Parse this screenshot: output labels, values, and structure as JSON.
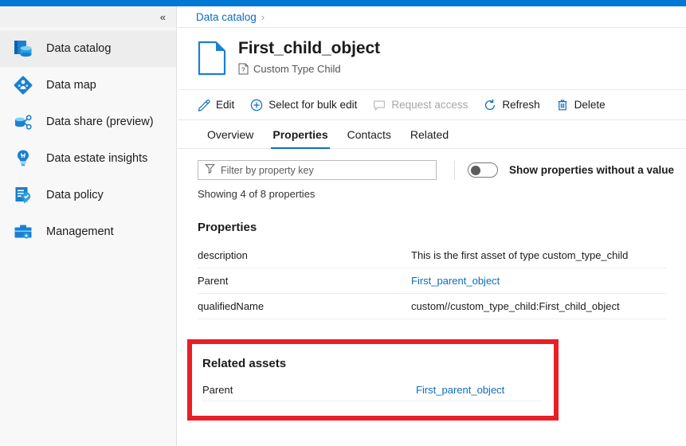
{
  "theme": {
    "accent": "#0078d4",
    "link": "#0f6cbd",
    "highlight_box": "#e81f25",
    "text": "#1b1b1b",
    "disabled": "#a6a6a6"
  },
  "sidebar": {
    "collapse_label": "«",
    "items": [
      {
        "label": "Data catalog",
        "icon": "data-catalog-icon",
        "selected": true
      },
      {
        "label": "Data map",
        "icon": "data-map-icon",
        "selected": false
      },
      {
        "label": "Data share (preview)",
        "icon": "data-share-icon",
        "selected": false
      },
      {
        "label": "Data estate insights",
        "icon": "data-estate-insights-icon",
        "selected": false
      },
      {
        "label": "Data policy",
        "icon": "data-policy-icon",
        "selected": false
      },
      {
        "label": "Management",
        "icon": "management-icon",
        "selected": false
      }
    ]
  },
  "breadcrumb": {
    "root": "Data catalog",
    "separator": "›"
  },
  "asset": {
    "title": "First_child_object",
    "subtitle": "Custom Type Child",
    "icon": "document-icon",
    "subtype_icon": "unknown-type-icon"
  },
  "toolbar": {
    "buttons": [
      {
        "label": "Edit",
        "icon": "pencil-icon",
        "disabled": false
      },
      {
        "label": "Select for bulk edit",
        "icon": "plus-circle-icon",
        "disabled": false
      },
      {
        "label": "Request access",
        "icon": "comment-icon",
        "disabled": true
      },
      {
        "label": "Refresh",
        "icon": "refresh-icon",
        "disabled": false
      },
      {
        "label": "Delete",
        "icon": "trash-icon",
        "disabled": false
      }
    ]
  },
  "tabs": [
    {
      "label": "Overview",
      "active": false
    },
    {
      "label": "Properties",
      "active": true
    },
    {
      "label": "Contacts",
      "active": false
    },
    {
      "label": "Related",
      "active": false
    }
  ],
  "filter": {
    "placeholder": "Filter by property key",
    "value": "",
    "icon": "filter-icon"
  },
  "toggle": {
    "label": "Show properties without a value",
    "state": "off"
  },
  "showing_text": "Showing 4 of 8 properties",
  "properties_section": {
    "heading": "Properties",
    "rows": [
      {
        "key": "description",
        "value": "This is the first asset of type custom_type_child",
        "is_link": false
      },
      {
        "key": "Parent",
        "value": "First_parent_object",
        "is_link": true
      },
      {
        "key": "qualifiedName",
        "value": "custom//custom_type_child:First_child_object",
        "is_link": false
      }
    ]
  },
  "related_section": {
    "heading": "Related assets",
    "rows": [
      {
        "key": "Parent",
        "value": "First_parent_object",
        "is_link": true
      }
    ]
  }
}
